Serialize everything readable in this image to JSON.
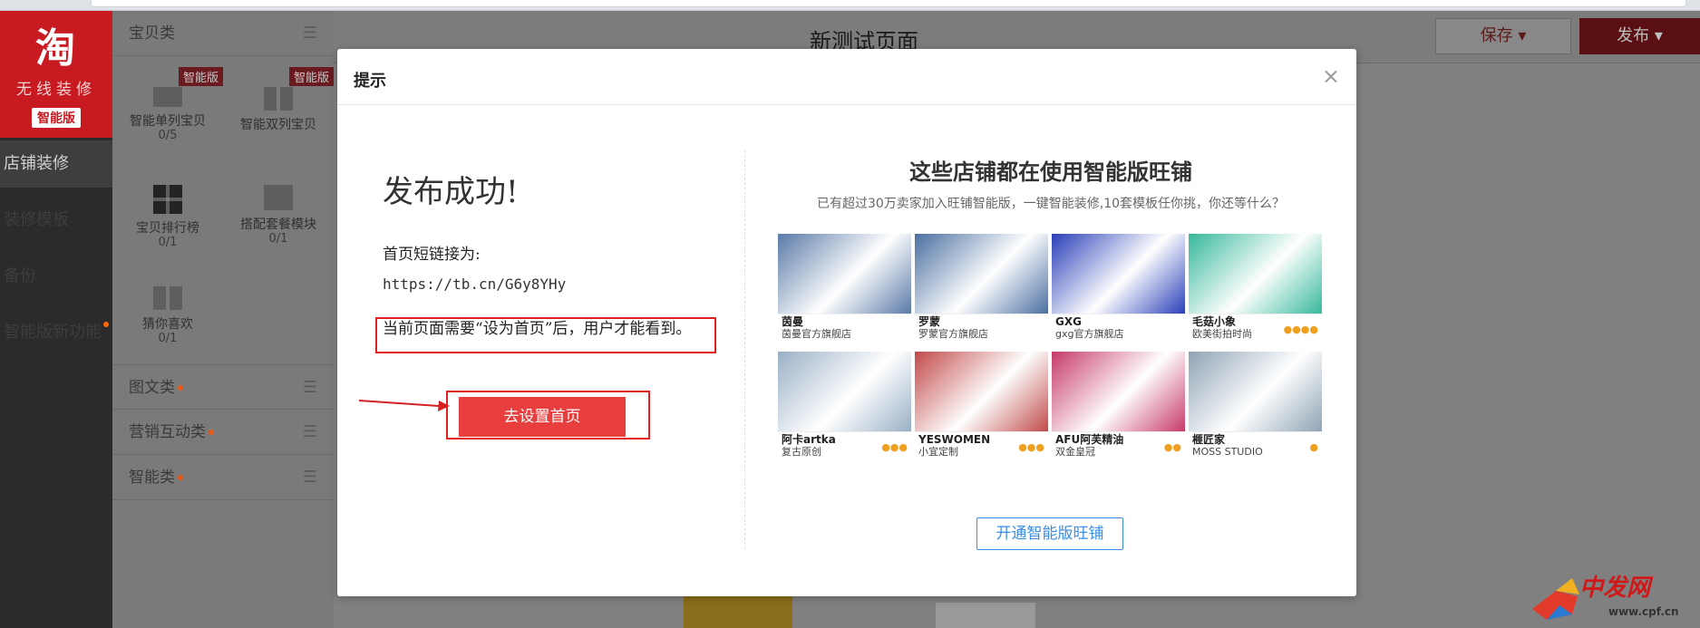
{
  "sidebar": {
    "logo_glyph": "淘",
    "logo_sub": "无线装修",
    "logo_badge": "智能版",
    "items": [
      {
        "label": "店铺装修"
      },
      {
        "label": "装修模板"
      },
      {
        "label": "备份"
      },
      {
        "label": "智能版新功能"
      }
    ]
  },
  "panel": {
    "section_baby": "宝贝类",
    "widgets": [
      {
        "name": "智能单列宝贝",
        "count": "0/5",
        "tag": "智能版"
      },
      {
        "name": "智能双列宝贝",
        "count": "",
        "tag": "智能版"
      },
      {
        "name": "宝贝排行榜",
        "count": "0/1",
        "tag": ""
      },
      {
        "name": "搭配套餐模块",
        "count": "0/1",
        "tag": ""
      },
      {
        "name": "猜你喜欢",
        "count": "0/1",
        "tag": ""
      }
    ],
    "section_graphic": "图文类",
    "section_marketing": "营销互动类",
    "section_smart": "智能类"
  },
  "header": {
    "title": "新测试页面",
    "save_label": "保存",
    "publish_label": "发布"
  },
  "modal": {
    "title": "提示",
    "close": "×",
    "success": "发布成功!",
    "link_label": "首页短链接为:",
    "link_url": "https://tb.cn/G6y8YHy",
    "notice": "当前页面需要“设为首页”后，用户才能看到。",
    "set_home_button": "去设置首页",
    "promo_title": "这些店铺都在使用智能版旺铺",
    "promo_subtitle": "已有超过30万卖家加入旺铺智能版，一键智能装修,10套模板任你挑，你还等什么？",
    "open_button": "开通智能版旺铺",
    "shops": [
      {
        "brand": "茵曼",
        "caption": "茵曼官方旗舰店",
        "color": "#5a7aa8"
      },
      {
        "brand": "罗蒙",
        "caption": "罗蒙官方旗舰店",
        "color": "#4a6fa0"
      },
      {
        "brand": "GXG",
        "caption": "gxg官方旗舰店",
        "color": "#2a3fb8"
      },
      {
        "brand": "毛菇小象",
        "caption": "欧美街拍时尚",
        "color": "#36b89a"
      },
      {
        "brand": "阿卡artka",
        "caption": "复古原创",
        "color": "#9ab0c6"
      },
      {
        "brand": "YESWOMEN",
        "caption": "小宜定制",
        "color": "#c24a4a"
      },
      {
        "brand": "AFU阿芙精油",
        "caption": "双金皇冠",
        "color": "#c63a6a"
      },
      {
        "brand": "榧匠家",
        "caption": "MOSS STUDIO",
        "color": "#8fa3b5"
      }
    ]
  },
  "watermark": {
    "text": "中发网",
    "url": "www.cpf.cn"
  }
}
